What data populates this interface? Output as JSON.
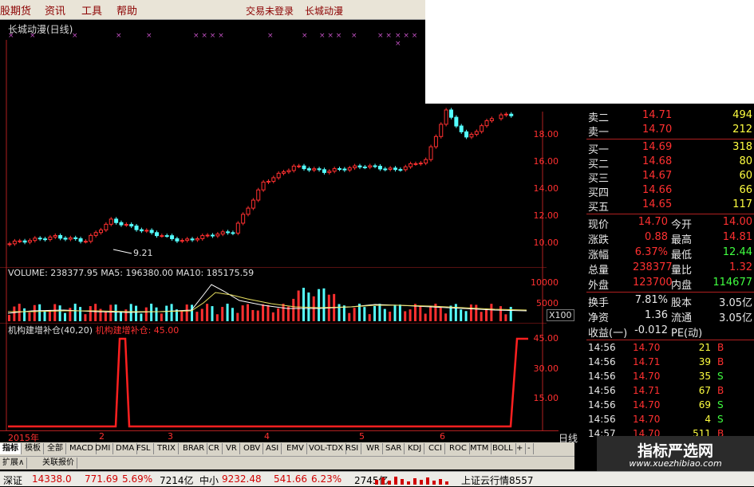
{
  "menu": {
    "items": [
      "股期货",
      "资讯",
      "工具",
      "帮助"
    ],
    "titles": [
      "交易未登录",
      "长城动漫"
    ]
  },
  "chart": {
    "title": "长城动漫(日线)",
    "price_axis": [
      "18.00",
      "16.00",
      "14.00",
      "12.00",
      "10.00"
    ],
    "min_label": "9.21",
    "volume_title": "VOLUME: 238377.95  MA5: 196380.00  MA10: 185175.59",
    "volume_axis": [
      "10000",
      "5000"
    ],
    "volume_unit": "X100",
    "indicator_title": "机构建增补仓(40,20)",
    "indicator_series_label": "机构建增补仓: 45.00",
    "indicator_axis": [
      "45.00",
      "30.00",
      "15.00"
    ],
    "dates": [
      "2015年",
      "2",
      "3",
      "4",
      "5",
      "6"
    ],
    "period": "日线"
  },
  "quote": {
    "sell": [
      {
        "label": "卖二",
        "price": "14.71",
        "vol": "494"
      },
      {
        "label": "卖一",
        "price": "14.70",
        "vol": "212"
      }
    ],
    "buy": [
      {
        "label": "买一",
        "price": "14.69",
        "vol": "318"
      },
      {
        "label": "买二",
        "price": "14.68",
        "vol": "80"
      },
      {
        "label": "买三",
        "price": "14.67",
        "vol": "60"
      },
      {
        "label": "买四",
        "price": "14.66",
        "vol": "66"
      },
      {
        "label": "买五",
        "price": "14.65",
        "vol": "117"
      }
    ],
    "stats": [
      {
        "l1": "现价",
        "v1": "14.70",
        "l2": "今开",
        "v2": "14.00"
      },
      {
        "l1": "涨跌",
        "v1": "0.88",
        "l2": "最高",
        "v2": "14.81"
      },
      {
        "l1": "涨幅",
        "v1": "6.37%",
        "l2": "最低",
        "v2": "12.44"
      },
      {
        "l1": "总量",
        "v1": "238377",
        "l2": "量比",
        "v2": "1.32"
      },
      {
        "l1": "外盘",
        "v1": "123700",
        "l2": "内盘",
        "v2": "114677"
      }
    ],
    "fin": [
      {
        "l1": "换手",
        "v1": "7.81%",
        "l2": "股本",
        "v2": "3.05亿"
      },
      {
        "l1": "净资",
        "v1": "1.36",
        "l2": "流通",
        "v2": "3.05亿"
      },
      {
        "l1": "收益(一)",
        "v1": "-0.012",
        "l2": "PE(动)",
        "v2": ""
      }
    ],
    "ticks": [
      {
        "time": "14:56",
        "price": "14.70",
        "vol": "21",
        "side": "B"
      },
      {
        "time": "14:56",
        "price": "14.71",
        "vol": "39",
        "side": "B"
      },
      {
        "time": "14:56",
        "price": "14.70",
        "vol": "35",
        "side": "S"
      },
      {
        "time": "14:56",
        "price": "14.71",
        "vol": "67",
        "side": "B"
      },
      {
        "time": "14:56",
        "price": "14.70",
        "vol": "69",
        "side": "S"
      },
      {
        "time": "14:56",
        "price": "14.70",
        "vol": "4",
        "side": "S"
      },
      {
        "time": "14:57",
        "price": "14.70",
        "vol": "511",
        "side": "B"
      }
    ]
  },
  "tabs": [
    "指标",
    "模板",
    "全部",
    "MACD",
    "DMI",
    "DMA",
    "FSL",
    "TRIX",
    "BRAR",
    "CR",
    "VR",
    "OBV",
    "ASI",
    "EMV",
    "VOL-TDX",
    "RSI",
    "WR",
    "SAR",
    "KDJ",
    "CCI",
    "ROC",
    "MTM",
    "BOLL",
    "+",
    "-"
  ],
  "tabs2": [
    "扩展∧",
    "关联报价"
  ],
  "status": {
    "sz_label": "深证",
    "sz_index": "14338.0",
    "sz_chg": "771.69",
    "sz_pct": "5.69%",
    "sz_amt": "7214亿",
    "zx_label": "中小",
    "zx_index": "9232.48",
    "zx_chg": "541.66",
    "zx_pct": "6.23%",
    "zx_amt": "2745亿",
    "right": "上证云行情8557"
  },
  "watermark": {
    "title": "指标严选网",
    "url": "www.xuezhibiao.com"
  },
  "colors": {
    "up": "#ff3030",
    "down": "#54ffff",
    "yellow": "#ffff40",
    "green": "#40ff40",
    "ma_white": "#ffffff",
    "ma_yellow": "#e8e060"
  }
}
